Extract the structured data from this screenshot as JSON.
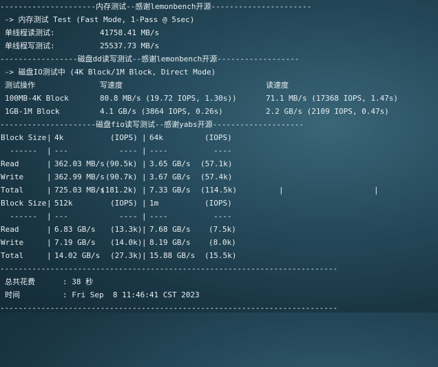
{
  "sections": {
    "mem_header": "---------------------内存测试--感谢lemonbench开源----------------------",
    "mem_mode": " -> 内存测试 Test (Fast Mode, 1-Pass @ 5sec)",
    "mem_read_label": "单线程读测试:",
    "mem_read_value": "41758.41 MB/s",
    "mem_write_label": "单线程写测试:",
    "mem_write_value": "25537.73 MB/s",
    "dd_header": "-----------------磁盘dd读写测试--感谢lemonbench开源------------------",
    "dd_mode": " -> 磁盘IO测试中 (4K Block/1M Block, Direct Mode)",
    "dd_col_op": "测试操作",
    "dd_col_write": "写速度",
    "dd_col_read": "读速度",
    "dd_rows": [
      {
        "op": "100MB-4K Block",
        "write": "80.8 MB/s (19.72 IOPS, 1.30s))",
        "read": "71.1 MB/s (17368 IOPS, 1.47s)"
      },
      {
        "op": "1GB-1M Block",
        "write": "4.1 GB/s (3864 IOPS, 0.26s)",
        "read": "2.2 GB/s (2109 IOPS, 0.47s)"
      }
    ],
    "fio_header": "---------------------磁盘fio读写测试--感谢yabs开源--------------------",
    "fio_rows": [
      {
        "a": "Block Size",
        "b": "4k",
        "c": "(IOPS)",
        "d": "64k",
        "e": "(IOPS)"
      },
      {
        "a": "  ------",
        "b": "---",
        "c": "----",
        "d": "----",
        "e": "----"
      },
      {
        "a": "Read",
        "b": "362.03 MB/s",
        "c": "(90.5k)",
        "d": "3.65 GB/s",
        "e": "(57.1k)"
      },
      {
        "a": "Write",
        "b": "362.99 MB/s",
        "c": "(90.7k)",
        "d": "3.67 GB/s",
        "e": "(57.4k)"
      },
      {
        "a": "Total",
        "b": "725.03 MB/s",
        "c": "(181.2k)",
        "d": "7.33 GB/s",
        "e": "(114.5k)"
      },
      {
        "a": "Block Size",
        "b": "512k",
        "c": "(IOPS)",
        "d": "1m",
        "e": "(IOPS)"
      },
      {
        "a": "  ------",
        "b": "---",
        "c": "----",
        "d": "----",
        "e": "----"
      },
      {
        "a": "Read",
        "b": "6.83 GB/s",
        "c": "(13.3k)",
        "d": "7.68 GB/s",
        "e": "(7.5k)"
      },
      {
        "a": "Write",
        "b": "7.19 GB/s",
        "c": "(14.0k)",
        "d": "8.19 GB/s",
        "e": "(8.0k)"
      },
      {
        "a": "Total",
        "b": "14.02 GB/s",
        "c": "(27.3k)",
        "d": "15.88 GB/s",
        "e": "(15.5k)"
      }
    ],
    "pipe": "|",
    "footer_sep": "--------------------------------------------------------------------------",
    "total_time_label": "总共花费",
    "total_time_value": ": 38 秒",
    "time_label": "时间",
    "time_value": ": Fri Sep  8 11:46:41 CST 2023"
  }
}
